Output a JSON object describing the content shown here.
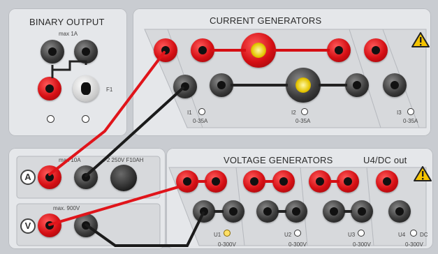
{
  "binary_output": {
    "title": "BINARY OUTPUT",
    "max_label": "max  1A",
    "fuse_label": "F1"
  },
  "current_generators": {
    "title": "CURRENT GENERATORS",
    "channels": [
      {
        "name": "I1",
        "range": "0-35A"
      },
      {
        "name": "I2",
        "range": "0-35A"
      },
      {
        "name": "I3",
        "range": "0-35A"
      }
    ]
  },
  "ammeter": {
    "symbol": "A",
    "max_label": "max  10A",
    "fuse_label": "F2  250V  F10AH"
  },
  "voltmeter": {
    "symbol": "V",
    "max_label": "max. 900V"
  },
  "voltage_generators": {
    "title": "VOLTAGE GENERATORS",
    "aux_title": "U4/DC out",
    "channels": [
      {
        "name": "U1",
        "range": "0-300V"
      },
      {
        "name": "U2",
        "range": "0-300V"
      },
      {
        "name": "U3",
        "range": "0-300V"
      },
      {
        "name": "U4",
        "extra": "DC",
        "range": "0-300V"
      }
    ]
  },
  "colors": {
    "panel": "#e5e7ea",
    "background": "#c9ccd1",
    "wire_red": "#e0141a",
    "wire_black": "#1b1b1b",
    "warning": "#f5c400"
  },
  "icons": [
    "warning-icon",
    "ammeter-icon",
    "voltmeter-icon",
    "fuse-icon"
  ]
}
